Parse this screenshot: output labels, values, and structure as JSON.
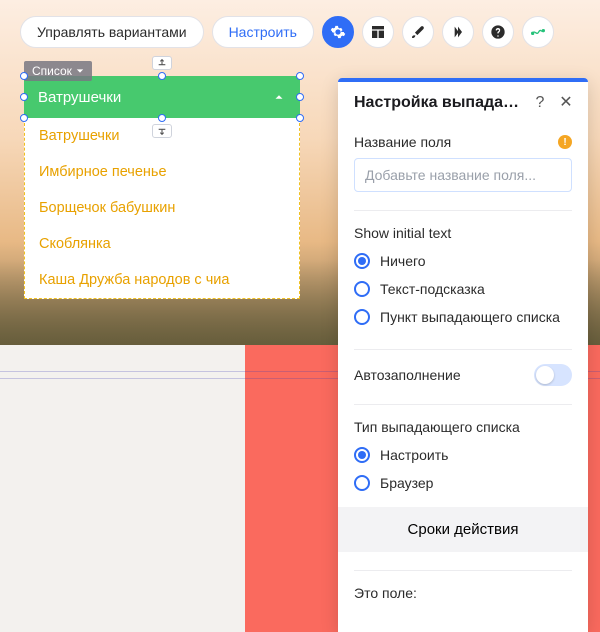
{
  "toolbar": {
    "manage_variants": "Управлять вариантами",
    "configure": "Настроить"
  },
  "selection_tag": "Список",
  "dropdown": {
    "selected": "Ватрушечки",
    "items": [
      "Ватрушечки",
      "Имбирное печенье",
      "Борщечок бабушкин",
      "Скоблянка",
      "Каша Дружба народов с чиа"
    ]
  },
  "panel": {
    "title": "Настройка выпадаю…",
    "field_name_label": "Название поля",
    "field_name_placeholder": "Добавьте название поля...",
    "show_initial_label": "Show initial text",
    "show_initial_options": {
      "none": "Ничего",
      "hint": "Текст-подсказка",
      "item": "Пункт выпадающего списка"
    },
    "autofill_label": "Автозаполнение",
    "type_label": "Тип выпадающего списка",
    "type_options": {
      "configure": "Настроить",
      "browser": "Браузер"
    },
    "deadlines_button": "Сроки действия",
    "this_field_label": "Это поле:"
  }
}
